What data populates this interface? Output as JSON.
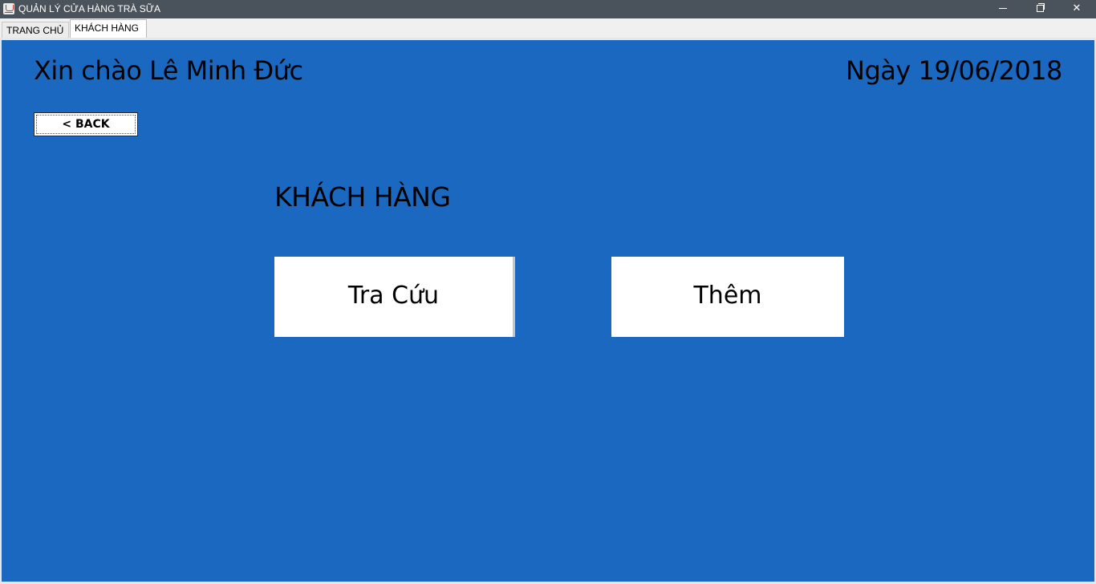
{
  "window": {
    "title": "QUẢN LÝ CỬA HÀNG TRÀ SỮA",
    "minimize_icon": "minimize-icon",
    "maximize_icon": "restore-icon",
    "close_glyph": "✕"
  },
  "tabs": [
    {
      "label": "TRANG CHỦ",
      "selected": false
    },
    {
      "label": "KHÁCH HÀNG",
      "selected": true
    }
  ],
  "header": {
    "greeting": "Xin chào Lê Minh Đức",
    "date": "Ngày 19/06/2018"
  },
  "back_button": {
    "label": "< BACK"
  },
  "section": {
    "title": "KHÁCH HÀNG"
  },
  "actions": {
    "lookup_label": "Tra Cứu",
    "add_label": "Thêm"
  },
  "colors": {
    "panel_background": "#1a68c0",
    "titlebar_background": "#4a525b",
    "button_background": "#ffffff"
  }
}
